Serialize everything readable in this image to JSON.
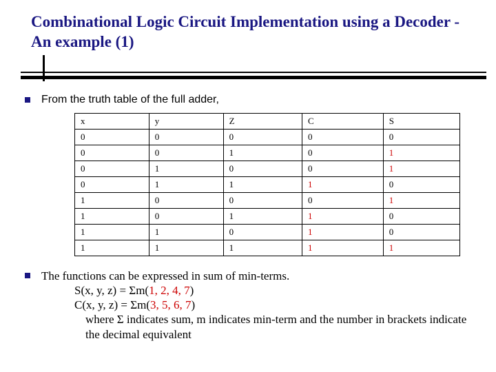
{
  "title": "Combinational Logic Circuit Implementation using a Decoder -  An example (1)",
  "intro": "From the truth table of the full adder,",
  "table": {
    "headers": [
      "x",
      "y",
      "Z",
      "C",
      "S"
    ],
    "rows": [
      [
        "0",
        "0",
        "0",
        "0",
        "0"
      ],
      [
        "0",
        "0",
        "1",
        "0",
        "1"
      ],
      [
        "0",
        "1",
        "0",
        "0",
        "1"
      ],
      [
        "0",
        "1",
        "1",
        "1",
        "0"
      ],
      [
        "1",
        "0",
        "0",
        "0",
        "1"
      ],
      [
        "1",
        "0",
        "1",
        "1",
        "0"
      ],
      [
        "1",
        "1",
        "0",
        "1",
        "0"
      ],
      [
        "1",
        "1",
        "1",
        "1",
        "1"
      ]
    ],
    "red_cols": [
      3,
      4
    ]
  },
  "conclusion": {
    "line1": "The functions can be expressed in sum of min-terms.",
    "s_label": "S(x, y, z) = Σm(",
    "s_terms": "1, 2, 4, 7",
    "c_label": "C(x, y, z) = Σm(",
    "c_terms": "3, 5, 6, 7",
    "close": ")",
    "where": "where Σ indicates sum, m indicates min-term and the number in brackets  indicate the decimal equivalent"
  }
}
